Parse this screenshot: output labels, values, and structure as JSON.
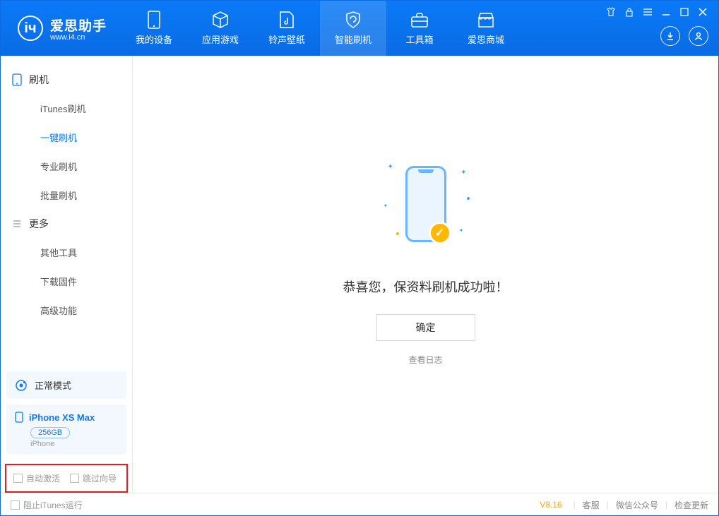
{
  "app": {
    "title": "爱思助手",
    "subtitle": "www.i4.cn"
  },
  "topTabs": [
    {
      "label": "我的设备"
    },
    {
      "label": "应用游戏"
    },
    {
      "label": "铃声壁纸"
    },
    {
      "label": "智能刷机"
    },
    {
      "label": "工具箱"
    },
    {
      "label": "爱思商城"
    }
  ],
  "sidebar": {
    "group1": {
      "title": "刷机"
    },
    "items1": [
      {
        "label": "iTunes刷机"
      },
      {
        "label": "一键刷机"
      },
      {
        "label": "专业刷机"
      },
      {
        "label": "批量刷机"
      }
    ],
    "group2": {
      "title": "更多"
    },
    "items2": [
      {
        "label": "其他工具"
      },
      {
        "label": "下载固件"
      },
      {
        "label": "高级功能"
      }
    ],
    "status": "正常模式",
    "device": {
      "name": "iPhone XS Max",
      "capacity": "256GB",
      "type": "iPhone"
    },
    "checks": {
      "auto_activate": "自动激活",
      "skip_guide": "跳过向导"
    }
  },
  "main": {
    "success_text": "恭喜您，保资料刷机成功啦！",
    "confirm": "确定",
    "view_log": "查看日志"
  },
  "footer": {
    "block_itunes": "阻止iTunes运行",
    "version": "V8.16",
    "support": "客服",
    "wechat": "微信公众号",
    "check_update": "检查更新"
  }
}
